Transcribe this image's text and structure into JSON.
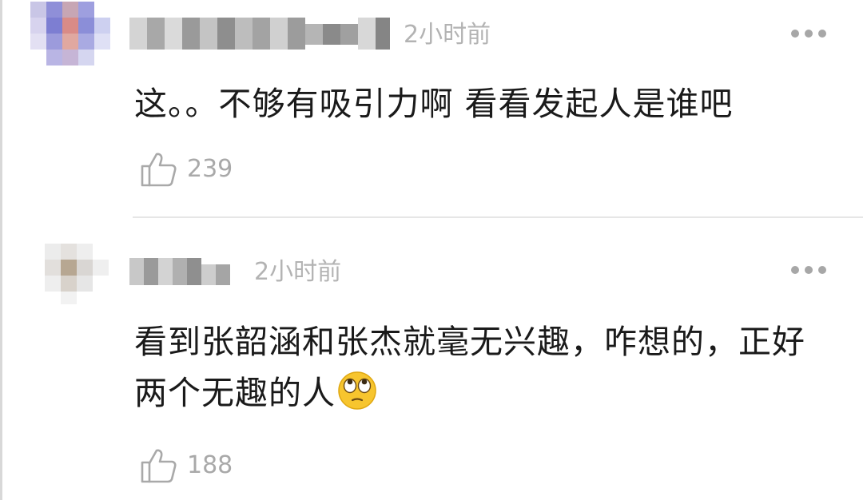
{
  "comments": [
    {
      "time": "2小时前",
      "text": "这。。不够有吸引力啊   看看发起人是谁吧",
      "like_count": "239",
      "avatar_icon": "blurred-avatar",
      "more_icon": "ellipsis-icon",
      "like_icon": "thumbs-up-icon"
    },
    {
      "time": "2小时前",
      "text": "看到张韶涵和张杰就毫无兴趣，咋想的，正好两个无趣的人",
      "emoji": "eye-roll-emoji",
      "like_count": "188",
      "avatar_icon": "blurred-avatar",
      "more_icon": "ellipsis-icon",
      "like_icon": "thumbs-up-icon"
    }
  ],
  "colors": {
    "text": "#1a1a1a",
    "meta": "#b3b3b3",
    "icon": "#a7a7a7",
    "divider": "#e6e6e6",
    "background": "#ffffff"
  }
}
